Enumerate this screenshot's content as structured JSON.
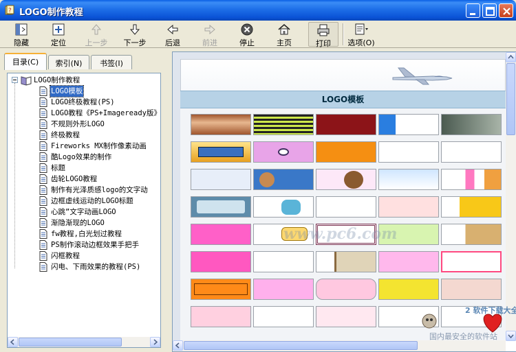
{
  "window": {
    "title": "LOGO制作教程"
  },
  "toolbar": {
    "buttons": [
      {
        "label": "隐藏",
        "icon": "hide-pane-icon",
        "enabled": true
      },
      {
        "label": "定位",
        "icon": "locate-icon",
        "enabled": true
      },
      {
        "label": "上一步",
        "icon": "up-arrow-icon",
        "enabled": false
      },
      {
        "label": "下一步",
        "icon": "down-arrow-icon",
        "enabled": true
      },
      {
        "label": "后退",
        "icon": "back-arrow-icon",
        "enabled": true
      },
      {
        "label": "前进",
        "icon": "forward-arrow-icon",
        "enabled": false
      },
      {
        "label": "停止",
        "icon": "stop-icon",
        "enabled": true
      },
      {
        "label": "主页",
        "icon": "home-icon",
        "enabled": true
      },
      {
        "label": "打印",
        "icon": "print-icon",
        "enabled": true
      },
      {
        "label": "选项(O)",
        "icon": "options-icon",
        "enabled": true
      }
    ]
  },
  "tabs": [
    {
      "label": "目录(C)",
      "active": true
    },
    {
      "label": "索引(N)",
      "active": false
    },
    {
      "label": "书签(I)",
      "active": false
    }
  ],
  "tree": {
    "root": "LOGO制作教程",
    "items": [
      "LOGO模板",
      "LOGO终极教程(PS)",
      "LOGO教程《PS+Imageready版》",
      "不规则外形LOGO",
      "终极教程",
      "Fireworks MX制作像素动画",
      "酷Logo效果的制作",
      "标题",
      "齿轮LOGO教程",
      "制作有光泽质感logo的文字动",
      "边框虚线运动的LOGO标题",
      "心跳”文字动画LOGO",
      "渐隐渐现的LOGO",
      "fw教程,白光划过教程",
      "PS制作滚动边框效果手把手",
      "闪框教程",
      "闪电、下雨效果的教程(PS)"
    ],
    "selected_index": 0
  },
  "content": {
    "heading": "LOGO模板",
    "watermark": "www.pc6.com",
    "corner_text_1": "2 软件下载大全",
    "corner_text_2": "国内最安全的软件站"
  },
  "colors": {
    "titlebar": "#0a52d6",
    "selection": "#316ac5",
    "heading_bar": "#b7d2e6"
  }
}
